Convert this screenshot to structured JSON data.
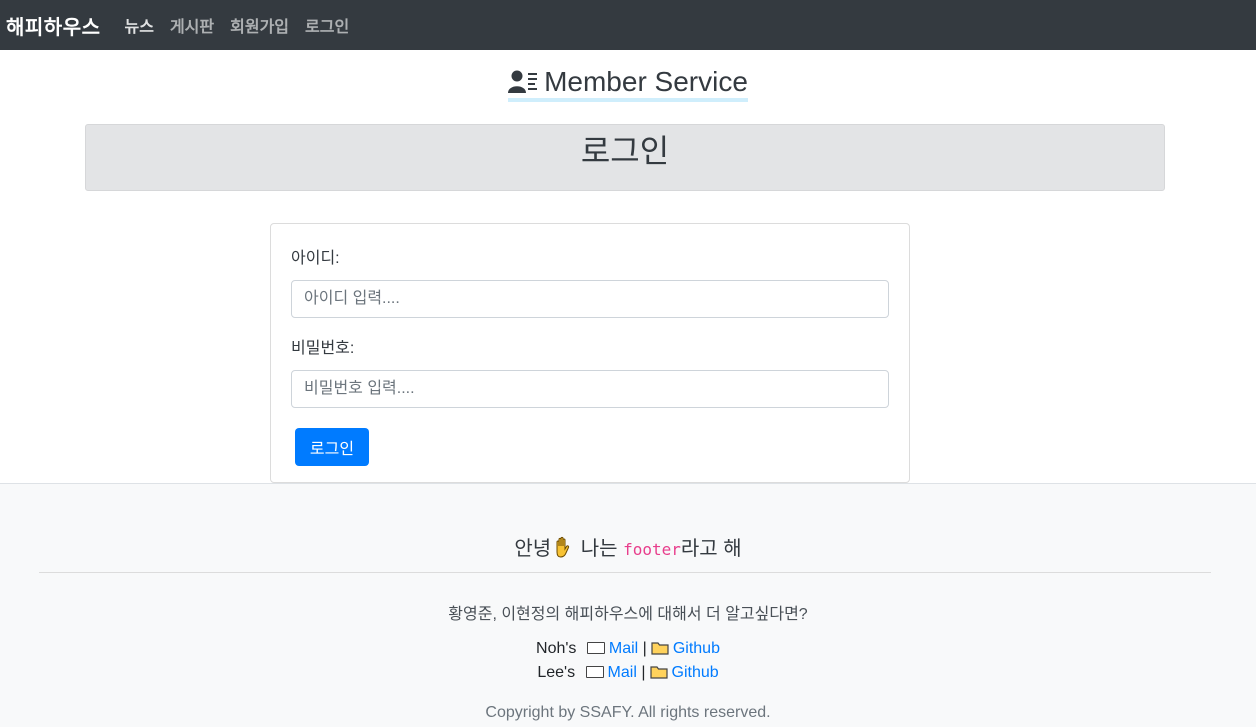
{
  "navbar": {
    "brand": "해피하우스",
    "links": [
      "뉴스",
      "게시판",
      "회원가입",
      "로그인"
    ]
  },
  "service": {
    "icon": "user-list-icon",
    "title": "Member Service"
  },
  "jumbotron": {
    "title": "로그인"
  },
  "login_form": {
    "id_label": "아이디:",
    "id_placeholder": "아이디 입력....",
    "pw_label": "비밀번호:",
    "pw_placeholder": "비밀번호 입력....",
    "submit_label": "로그인"
  },
  "footer": {
    "greet_before": "안녕",
    "greet_middle": " 나는 ",
    "greet_code": "footer",
    "greet_after": "라고 해",
    "about": "황영준, 이현정의 해피하우스에 대해서 더 알고싶다면?",
    "contacts": [
      {
        "name": "Noh's",
        "mail": "Mail",
        "sep": "|",
        "github": "Github"
      },
      {
        "name": "Lee's",
        "mail": "Mail",
        "sep": "|",
        "github": "Github"
      }
    ],
    "copyright": "Copyright by SSAFY. All rights reserved."
  },
  "colors": {
    "navbar_bg": "#343a40",
    "primary": "#007bff",
    "jumbo_bg": "#e3e4e6",
    "footer_bg": "#f8f9fa",
    "code": "#e83e8c"
  }
}
